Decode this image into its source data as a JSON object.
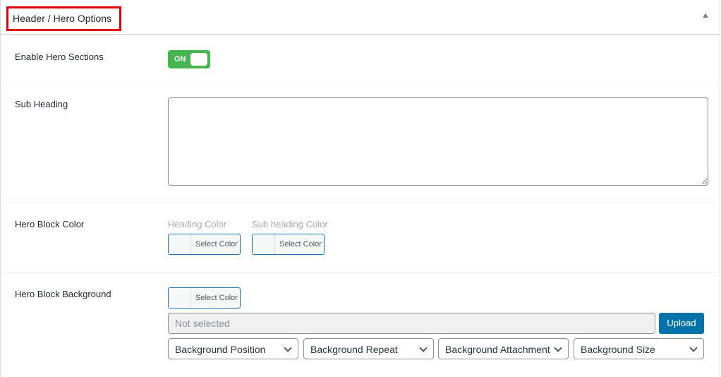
{
  "panel": {
    "title": "Header / Hero Options",
    "toggle_icon": "collapse-arrow-up-icon"
  },
  "rows": {
    "enable_hero": {
      "label": "Enable Hero Sections",
      "switch_text": "ON",
      "switch_state": "on",
      "switch_color": "#46b450"
    },
    "sub_heading": {
      "label": "Sub Heading",
      "value": "",
      "placeholder": ""
    },
    "hero_block_color": {
      "label": "Hero Block Color",
      "heading_color_label": "Heading Color",
      "heading_color_button": "Select Color",
      "sub_heading_color_label": "Sub heading Color",
      "sub_heading_color_button": "Select Color"
    },
    "hero_block_background": {
      "label": "Hero Block Background",
      "color_button": "Select Color",
      "file_value": "Not selected",
      "upload_label": "Upload",
      "upload_color": "#0073aa",
      "selects": [
        {
          "value": "Background Position"
        },
        {
          "value": "Background Repeat"
        },
        {
          "value": "Background Attachment"
        },
        {
          "value": "Background Size"
        }
      ]
    }
  },
  "colors": {
    "highlight_border": "#e3000b",
    "accent": "#2271b1"
  }
}
